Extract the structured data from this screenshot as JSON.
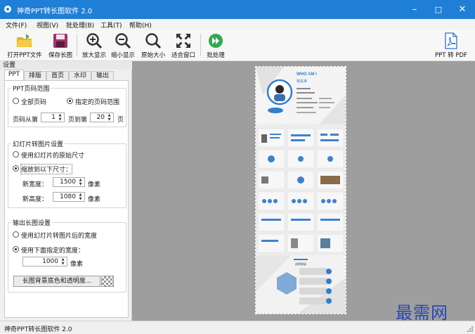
{
  "window": {
    "title": "神奇PPT转长图软件 2.0",
    "controls": {
      "minimize": "–",
      "maximize": "□",
      "close": "✕"
    }
  },
  "menu": [
    "文件(F)",
    "视图(V)",
    "批处理(B)",
    "工具(T)",
    "帮助(H)"
  ],
  "toolbar": {
    "open": "打开PPT文件",
    "save": "保存长图",
    "zoom_in": "放大显示",
    "zoom_out": "缩小显示",
    "original": "原始大小",
    "fit": "适合窗口",
    "batch": "批处理",
    "ppt_to_pdf": "PPT 转 PDF"
  },
  "panel": {
    "header": "设置",
    "tabs": [
      "PPT",
      "排版",
      "首页",
      "水印",
      "输出"
    ],
    "page_range": {
      "title": "PPT页码范围",
      "all": "全部页码",
      "specified": "指定的页码范围",
      "from_label": "页码从第",
      "from_value": "1",
      "to_label": "页到第",
      "to_value": "20",
      "page_suffix": "页"
    },
    "slide_image": {
      "title": "幻灯片转图片设置",
      "original": "使用幻灯片的原始尺寸",
      "scale": "缩放到以下尺寸：",
      "width_label": "新宽度：",
      "width_value": "1500",
      "height_label": "新高度：",
      "height_value": "1080",
      "unit": "像素"
    },
    "output": {
      "title": "输出长图设置",
      "use_slide_width": "使用幻灯片转图片后的宽度",
      "use_specified": "使用下面指定的宽度：",
      "width_value": "1000",
      "unit": "像素",
      "bg_button": "长图背景底色和透明度..."
    }
  },
  "preview": {
    "header_title": "WHO AM I",
    "header_name": "我是谁",
    "section_label": "选择原因"
  },
  "status": "神奇PPT转长图软件 2.0",
  "watermark": "最需网",
  "colors": {
    "titlebar": "#1f7fd6",
    "accent": "#2f7fd0",
    "preview_bg": "#9e9e9e",
    "watermark": "#2447b8"
  }
}
